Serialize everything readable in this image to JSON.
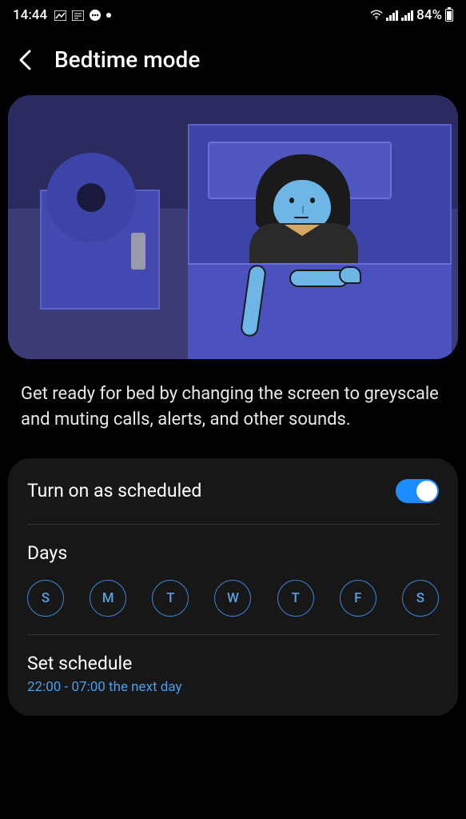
{
  "status": {
    "time": "14:44",
    "battery_percent": "84%"
  },
  "header": {
    "title": "Bedtime mode"
  },
  "description": "Get ready for bed by changing the screen to greyscale and muting calls, alerts, and other sounds.",
  "settings": {
    "schedule_toggle_label": "Turn on as scheduled",
    "schedule_toggle_on": true,
    "days_label": "Days",
    "days": [
      "S",
      "M",
      "T",
      "W",
      "T",
      "F",
      "S"
    ],
    "set_schedule_label": "Set schedule",
    "schedule_time": "22:00 - 07:00 the next day"
  }
}
